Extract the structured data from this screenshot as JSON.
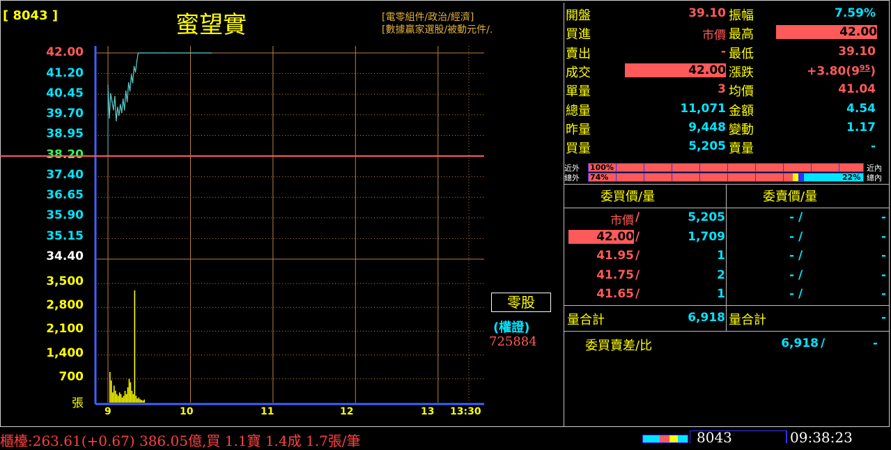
{
  "header": {
    "code": "[ 8043 ]",
    "name": "蜜望實",
    "categories": [
      "[電零組件/政治/經濟]",
      "[數據贏家選股/被動元件/."
    ]
  },
  "chart_data": [
    {
      "type": "line",
      "y_ticks": [
        "42.00",
        "41.20",
        "40.45",
        "39.70",
        "38.95",
        "38.20",
        "37.40",
        "36.65",
        "35.90",
        "35.15",
        "34.40"
      ],
      "reference": 38.2,
      "ylim": [
        34.4,
        42.0
      ],
      "x_ticks": [
        "9",
        "10",
        "11",
        "12",
        "13",
        "13:30"
      ],
      "price": [
        {
          "t": 0,
          "v": 40.8
        },
        {
          "t": 1,
          "v": 39.6
        },
        {
          "t": 2,
          "v": 40.5
        },
        {
          "t": 3,
          "v": 40.2
        },
        {
          "t": 4,
          "v": 39.9
        },
        {
          "t": 5,
          "v": 40.4
        },
        {
          "t": 6,
          "v": 39.5
        },
        {
          "t": 7,
          "v": 40.0
        },
        {
          "t": 8,
          "v": 39.7
        },
        {
          "t": 9,
          "v": 40.1
        },
        {
          "t": 10,
          "v": 39.8
        },
        {
          "t": 11,
          "v": 40.3
        },
        {
          "t": 12,
          "v": 39.9
        },
        {
          "t": 13,
          "v": 40.6
        },
        {
          "t": 14,
          "v": 40.2
        },
        {
          "t": 15,
          "v": 40.9
        },
        {
          "t": 16,
          "v": 40.6
        },
        {
          "t": 17,
          "v": 41.2
        },
        {
          "t": 18,
          "v": 40.9
        },
        {
          "t": 19,
          "v": 41.5
        },
        {
          "t": 20,
          "v": 41.3
        },
        {
          "t": 21,
          "v": 41.7
        },
        {
          "t": 22,
          "v": 42.0
        },
        {
          "t": 25,
          "v": 42.0
        },
        {
          "t": 40,
          "v": 42.0
        },
        {
          "t": 60,
          "v": 42.0
        },
        {
          "t": 75,
          "v": 42.0
        }
      ]
    },
    {
      "type": "bar",
      "y_ticks": [
        "3,500",
        "2,800",
        "2,100",
        "1,400",
        "700"
      ],
      "unit": "張",
      "ylim": [
        0,
        3500
      ],
      "volumes": [
        {
          "t": 0,
          "v": 900
        },
        {
          "t": 1,
          "v": 650
        },
        {
          "t": 2,
          "v": 300
        },
        {
          "t": 3,
          "v": 500
        },
        {
          "t": 4,
          "v": 350
        },
        {
          "t": 5,
          "v": 250
        },
        {
          "t": 6,
          "v": 200
        },
        {
          "t": 7,
          "v": 300
        },
        {
          "t": 8,
          "v": 250
        },
        {
          "t": 9,
          "v": 150
        },
        {
          "t": 10,
          "v": 200
        },
        {
          "t": 11,
          "v": 350
        },
        {
          "t": 12,
          "v": 250
        },
        {
          "t": 13,
          "v": 450
        },
        {
          "t": 14,
          "v": 700
        },
        {
          "t": 15,
          "v": 600
        },
        {
          "t": 16,
          "v": 350
        },
        {
          "t": 17,
          "v": 250
        },
        {
          "t": 18,
          "v": 3300
        },
        {
          "t": 19,
          "v": 200
        },
        {
          "t": 20,
          "v": 120
        },
        {
          "t": 21,
          "v": 150
        },
        {
          "t": 22,
          "v": 100
        },
        {
          "t": 23,
          "v": 80
        },
        {
          "t": 24,
          "v": 60
        },
        {
          "t": 25,
          "v": 90
        }
      ]
    }
  ],
  "labels": {
    "odd_lot": "零股",
    "warrant": "(權證)",
    "warrant_code": "725884"
  },
  "quote": {
    "left": [
      {
        "label": "開盤",
        "value": "39.10"
      },
      {
        "label": "買進",
        "value": "市價"
      },
      {
        "label": "賣出",
        "value": "-"
      },
      {
        "label": "成交",
        "value": "42.00"
      },
      {
        "label": "單量",
        "value": "3"
      },
      {
        "label": "總量",
        "value": "11,071"
      },
      {
        "label": "昨量",
        "value": "9,448"
      },
      {
        "label": "買量",
        "value": "5,205"
      }
    ],
    "right": [
      {
        "label": "振幅",
        "value": "7.59%"
      },
      {
        "label": "最高",
        "value": "42.00"
      },
      {
        "label": "最低",
        "value": "39.10"
      },
      {
        "label": "漲跌",
        "value": "+3.80(9",
        "sup": "95",
        "tail": ")"
      },
      {
        "label": "均價",
        "value": "41.04"
      },
      {
        "label": "金額",
        "value": "4.54"
      },
      {
        "label": "變動",
        "value": "1.17"
      },
      {
        "label": "賣量",
        "value": "-"
      }
    ]
  },
  "ratio_bars": {
    "row1_left": "近外",
    "row1_pct": "100%",
    "row1_right": "近內",
    "row2_left": "總外",
    "row2_pct": "74%",
    "row2_pct_right": "22%",
    "row2_right": "總內"
  },
  "order_book": {
    "bid_header": "委買價/量",
    "ask_header": "委賣價/量",
    "rows": [
      {
        "bid_price": "市價",
        "bid_qty": "5,205",
        "ask_price": "-",
        "ask_qty": "-"
      },
      {
        "bid_price": "42.00",
        "bid_qty": "1,709",
        "ask_price": "-",
        "ask_qty": "-"
      },
      {
        "bid_price": "41.95",
        "bid_qty": "1",
        "ask_price": "-",
        "ask_qty": "-"
      },
      {
        "bid_price": "41.75",
        "bid_qty": "2",
        "ask_price": "-",
        "ask_qty": "-"
      },
      {
        "bid_price": "41.65",
        "bid_qty": "1",
        "ask_price": "-",
        "ask_qty": "-"
      }
    ],
    "sep": "/",
    "bid_total_label": "量合計",
    "bid_total": "6,918",
    "ask_total_label": "量合計",
    "ask_total": "-",
    "diff_label": "委買賣差/比",
    "diff_value": "6,918",
    "diff_ratio": "-"
  },
  "status": {
    "ticker": "櫃檯:263.61(+0.67) 386.05億,買 1.1寶 1.4成 1.7張/筆",
    "code": "8043",
    "time": "09:38:23"
  },
  "colors": {
    "up": "#ff5a5a",
    "price_line": "#5fd0d0",
    "volume": "#ffff00",
    "axis": "#4060ff",
    "grid": "#c08040"
  }
}
